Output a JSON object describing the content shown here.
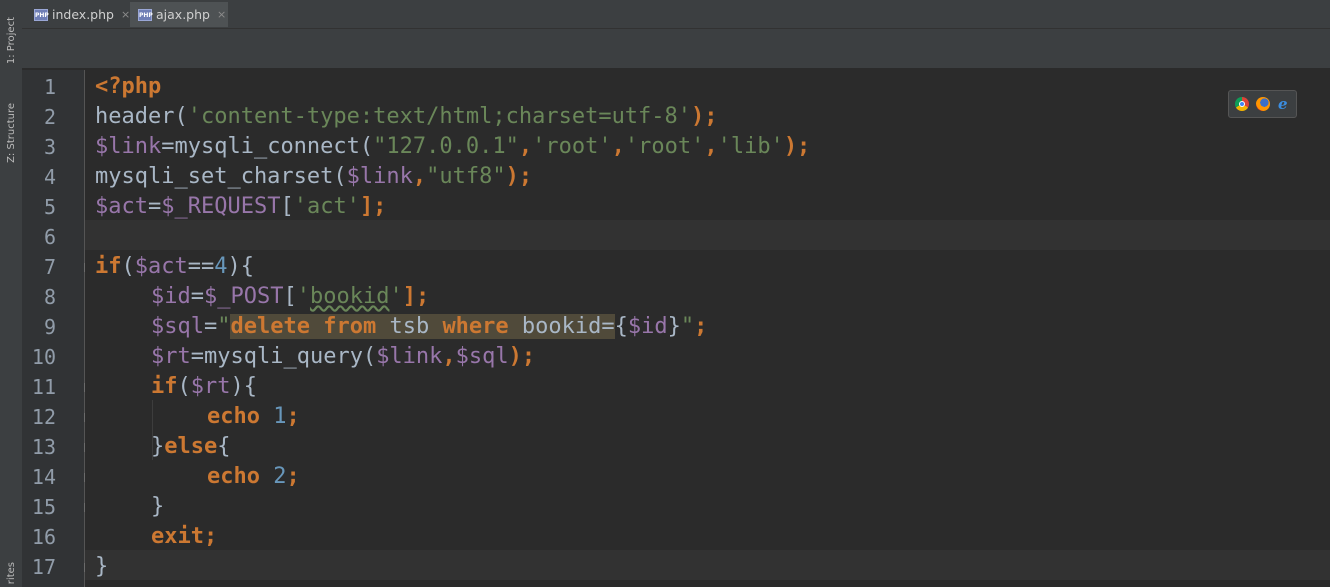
{
  "tool_windows": {
    "project": "1: Project",
    "structure": "Z: Structure",
    "favorites": "rites"
  },
  "tabs": [
    {
      "label": "index.php",
      "close": "×",
      "active": false
    },
    {
      "label": "ajax.php",
      "close": "×",
      "active": true
    }
  ],
  "line_numbers": [
    "1",
    "2",
    "3",
    "4",
    "5",
    "6",
    "7",
    "8",
    "9",
    "10",
    "11",
    "12",
    "13",
    "14",
    "15",
    "16",
    "17"
  ],
  "code": {
    "l1": "<?php",
    "l2": {
      "fn": "header(",
      "s": "'content-type:text/html;charset=utf-8'",
      "end": ");"
    },
    "l3": {
      "v": "$link",
      "eq": "=mysqli_connect(",
      "s1": "\"127.0.0.1\"",
      "c1": ",",
      "s2": "'root'",
      "c2": ",",
      "s3": "'root'",
      "c3": ",",
      "s4": "'lib'",
      "end": ");"
    },
    "l4": {
      "fn": "mysqli_set_charset(",
      "v": "$link",
      "c": ",",
      "s": "\"utf8\"",
      "end": ");"
    },
    "l5": {
      "v1": "$act",
      "eq": "=",
      "v2": "$_REQUEST",
      "b1": "[",
      "s": "'act'",
      "end": "];"
    },
    "l7": {
      "kw": "if",
      "p1": "(",
      "v": "$act",
      "op": "==",
      "n": "4",
      "end": "){"
    },
    "l8": {
      "v1": "$id",
      "eq": "=",
      "v2": "$_POST",
      "b1": "[",
      "s1": "'",
      "s2": "bookid",
      "s3": "'",
      "end": "];"
    },
    "l9": {
      "v": "$sql",
      "eq": "=",
      "q": "\"",
      "k1": "delete",
      "sp1": " ",
      "k2": "from",
      "t1": " tsb ",
      "k3": "where",
      "t2": " bookid=",
      "br1": "{",
      "v2": "$id",
      "br2": "}",
      "q2": "\"",
      "end": ";"
    },
    "l10": {
      "v1": "$rt",
      "eq": "=mysqli_query(",
      "v2": "$link",
      "c": ",",
      "v3": "$sql",
      "end": ");"
    },
    "l11": {
      "kw": "if",
      "p1": "(",
      "v": "$rt",
      "end": "){"
    },
    "l12": {
      "kw": "echo",
      "sp": " ",
      "n": "1",
      "end": ";"
    },
    "l13": {
      "b": "}",
      "kw": "else",
      "end": "{"
    },
    "l14": {
      "kw": "echo",
      "sp": " ",
      "n": "2",
      "end": ";"
    },
    "l15": "}",
    "l16": {
      "kw": "exit",
      "end": ";"
    },
    "l17": "}"
  },
  "browser_icons": [
    "chrome-icon",
    "firefox-icon",
    "ie-icon"
  ],
  "colors": {
    "keyword": "#cc7832",
    "string": "#6a8759",
    "variable": "#9876aa",
    "number": "#6897bb",
    "text": "#a9b7c6",
    "background": "#2b2b2b"
  }
}
